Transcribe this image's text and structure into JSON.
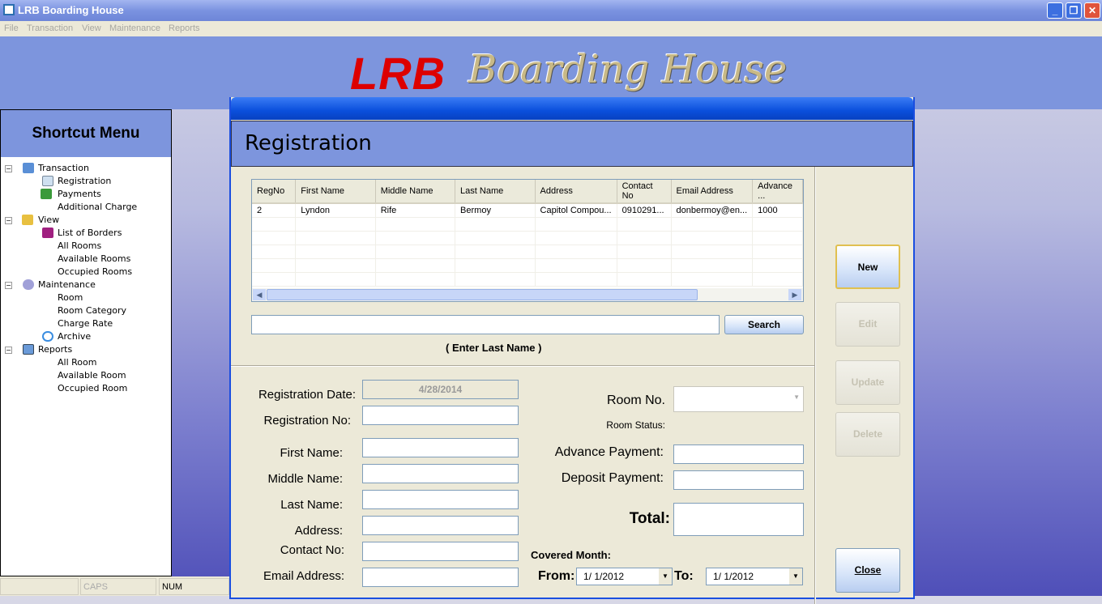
{
  "window": {
    "title": "LRB Boarding House",
    "minimize": "_",
    "restore": "❐",
    "close": "✕"
  },
  "menu": [
    "File",
    "Transaction",
    "View",
    "Maintenance",
    "Reports"
  ],
  "banner": {
    "logo_red": "LRB",
    "logo_script": "Boarding House"
  },
  "sidebar": {
    "title": "Shortcut Menu",
    "groups": [
      {
        "label": "Transaction",
        "items": [
          "Registration",
          "Payments",
          "Additional Charge"
        ]
      },
      {
        "label": "View",
        "items": [
          "List of Borders",
          "All Rooms",
          "Available Rooms",
          "Occupied Rooms"
        ]
      },
      {
        "label": "Maintenance",
        "items": [
          "Room",
          "Room Category",
          "Charge Rate",
          "Archive"
        ]
      },
      {
        "label": "Reports",
        "items": [
          "All Room",
          "Available Room",
          "Occupied Room"
        ]
      }
    ]
  },
  "statusbar": {
    "caps": "CAPS",
    "num": "NUM"
  },
  "dialog": {
    "title": "Registration",
    "grid": {
      "columns": [
        "RegNo",
        "First Name",
        "Middle Name",
        "Last Name",
        "Address",
        "Contact No",
        "Email Address",
        "Advance ..."
      ],
      "rows": [
        [
          "2",
          "Lyndon",
          "Rife",
          "Bermoy",
          "Capitol Compou...",
          "0910291...",
          "donbermoy@en...",
          "1000"
        ]
      ]
    },
    "search": {
      "value": "",
      "button": "Search",
      "hint": "( Enter Last Name )"
    },
    "form": {
      "registration_date_label": "Registration Date:",
      "registration_date": "4/28/2014",
      "registration_no_label": "Registration No:",
      "first_name_label": "First Name:",
      "middle_name_label": "Middle Name:",
      "last_name_label": "Last Name:",
      "address_label": "Address:",
      "contact_no_label": "Contact No:",
      "email_label": "Email Address:",
      "room_no_label": "Room No.",
      "room_status_label": "Room Status:",
      "advance_label": "Advance Payment:",
      "deposit_label": "Deposit Payment:",
      "total_label": "Total:",
      "covered_label": "Covered Month:",
      "from_label": "From:",
      "from_value": "1/ 1/2012",
      "to_label": "To:",
      "to_value": "1/ 1/2012"
    },
    "buttons": {
      "new": "New",
      "edit": "Edit",
      "update": "Update",
      "delete": "Delete",
      "close": "Close"
    }
  }
}
